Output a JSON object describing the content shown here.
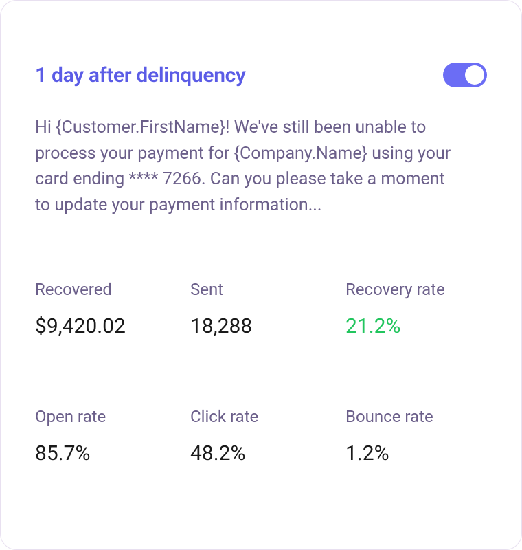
{
  "header": {
    "title": "1 day after delinquency",
    "toggle_on": true
  },
  "body": {
    "text": "Hi {Customer.FirstName}!  We've still been unable to process your payment for {Company.Name} using your card ending **** 7266. Can you please take a moment to update your payment information..."
  },
  "metrics": [
    {
      "label": "Recovered",
      "value": "$9,420.02",
      "highlight": false
    },
    {
      "label": "Sent",
      "value": "18,288",
      "highlight": false
    },
    {
      "label": "Recovery rate",
      "value": "21.2%",
      "highlight": true
    },
    {
      "label": "Open rate",
      "value": "85.7%",
      "highlight": false
    },
    {
      "label": "Click rate",
      "value": "48.2%",
      "highlight": false
    },
    {
      "label": "Bounce rate",
      "value": "1.2%",
      "highlight": false
    }
  ]
}
